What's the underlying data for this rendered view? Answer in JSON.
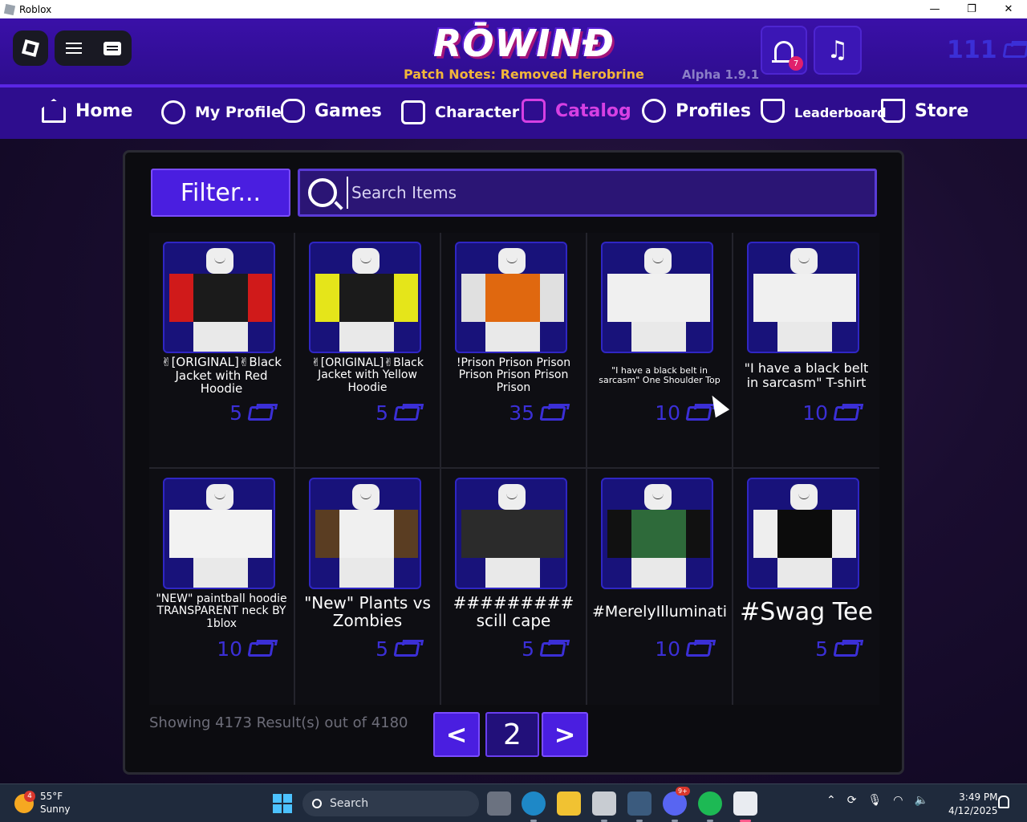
{
  "window": {
    "title": "Roblox",
    "controls": [
      "—",
      "❐",
      "✕"
    ]
  },
  "header": {
    "logo": "RŌWINĐ",
    "patch_notes": "Patch Notes: Removed Herobrine",
    "version": "Alpha 1.9.1",
    "notifications": "7",
    "currency": "111"
  },
  "nav": {
    "home": "Home",
    "my_profile": "My Profile",
    "games": "Games",
    "character": "Character",
    "catalog": "Catalog",
    "profiles": "Profiles",
    "leaderboard": "Leaderboard",
    "store": "Store"
  },
  "catalog": {
    "filter_label": "Filter...",
    "search_placeholder": "Search Items",
    "items": [
      {
        "name": "✌[ORIGINAL]✌Black Jacket with Red Hoodie",
        "price": "5",
        "shirt": "#1b1b1b",
        "accent": "#d01a1a"
      },
      {
        "name": "✌[ORIGINAL]✌Black Jacket with Yellow Hoodie",
        "price": "5",
        "shirt": "#1b1b1b",
        "accent": "#e5e51a"
      },
      {
        "name": "!Prison Prison Prison Prison Prison Prison Prison",
        "price": "35",
        "shirt": "#e0680f",
        "accent": "#e0e0e0"
      },
      {
        "name": "\"I have a black belt in sarcasm\" One Shoulder Top",
        "price": "10",
        "shirt": "#f0f0f0",
        "accent": "#f0f0f0"
      },
      {
        "name": "\"I have a black belt in sarcasm\" T-shirt",
        "price": "10",
        "shirt": "#f0f0f0",
        "accent": "#f0f0f0"
      },
      {
        "name": "\"NEW\" paintball hoodie TRANSPARENT neck BY 1blox",
        "price": "10",
        "shirt": "#f2f2f2",
        "accent": "#f2f2f2"
      },
      {
        "name": "\"New\" Plants vs Zombies",
        "price": "5",
        "shirt": "#f0f0f0",
        "accent": "#5a3d22"
      },
      {
        "name": "######### scill cape",
        "price": "5",
        "shirt": "#2b2b2b",
        "accent": "#2b2b2b"
      },
      {
        "name": "#MerelyIlluminati",
        "price": "10",
        "shirt": "#2e6a3a",
        "accent": "#111111"
      },
      {
        "name": "#Swag Tee",
        "price": "5",
        "shirt": "#0c0c0c",
        "accent": "#eeeeee"
      }
    ],
    "results_text": "Showing 4173 Result(s) out of 4180",
    "page": "2",
    "prev": "<",
    "next": ">"
  },
  "taskbar": {
    "weather_temp": "55°F",
    "weather_desc": "Sunny",
    "weather_badge": "4",
    "search_label": "Search",
    "discord_badge": "9+",
    "time": "3:49 PM",
    "date": "4/12/2025"
  }
}
